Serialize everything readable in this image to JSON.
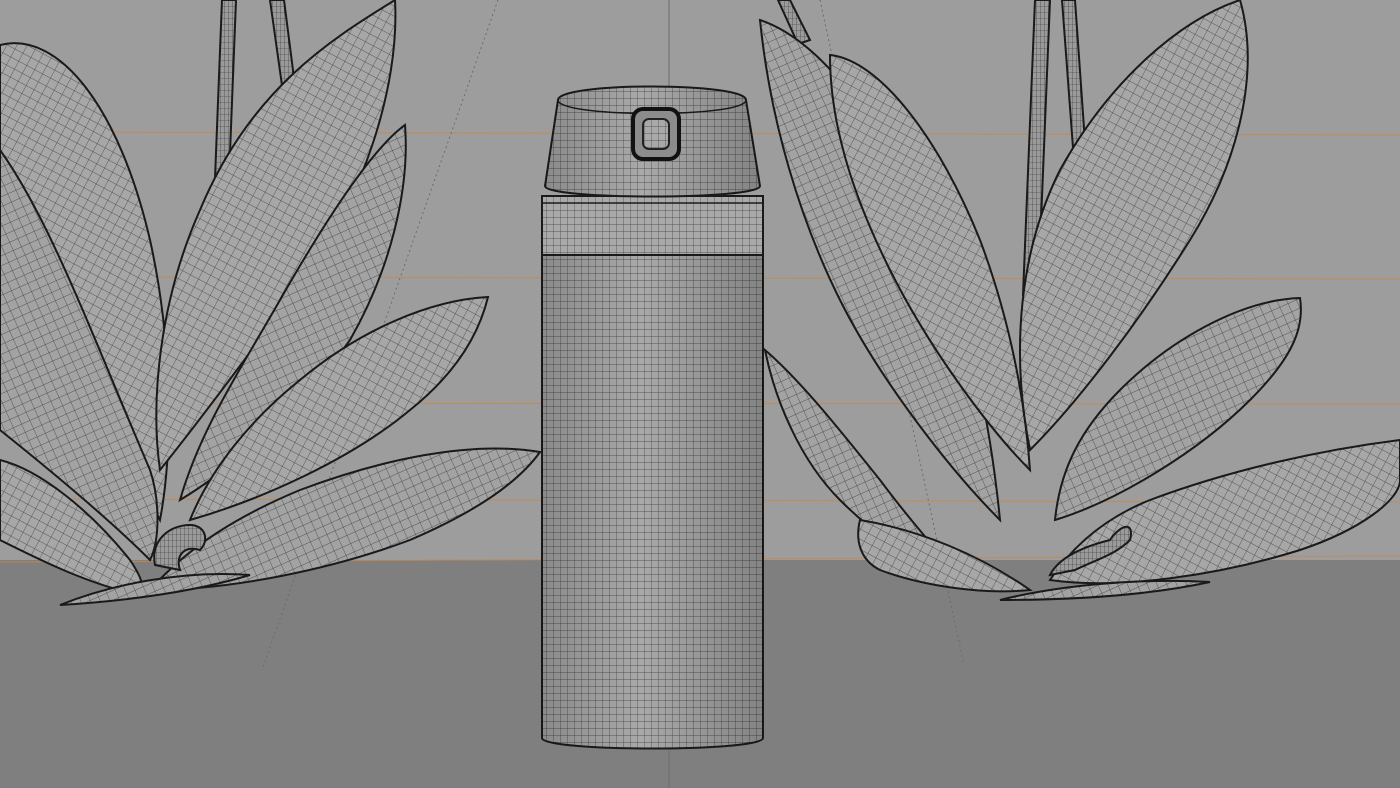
{
  "viewport": {
    "view": "perspective-wireframe",
    "colors": {
      "backdrop": "#9d9d9d",
      "floor": "#7f7f7f",
      "grid_line": "#c7884a",
      "axis_line": "#6c6c6c",
      "mesh_fill": "#a9a9a9",
      "mesh_line": "#3a3a3a",
      "outline": "#1a1a1a"
    },
    "objects": [
      {
        "name": "orchid-plant-left",
        "type": "mesh-wireframe"
      },
      {
        "name": "thermos-bottle",
        "type": "mesh-wireframe"
      },
      {
        "name": "orchid-plant-right",
        "type": "mesh-wireframe"
      }
    ]
  }
}
